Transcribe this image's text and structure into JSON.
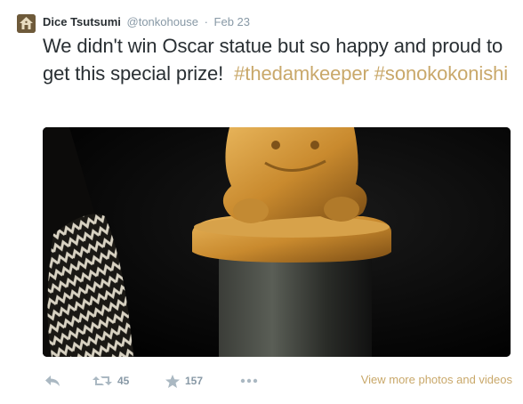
{
  "tweet": {
    "fullname": "Dice Tsutsumi",
    "username": "@tonkohouse",
    "separator": "·",
    "timestamp": "Feb 23",
    "text_plain": "We didn't win Oscar statue but so happy and proud to get this special prize!",
    "hashtags": [
      "#thedamkeeper",
      "#sonokokonishi"
    ],
    "accent_color": "#c9a86a"
  },
  "actions": {
    "reply_icon": "reply-icon",
    "retweet_icon": "retweet-icon",
    "retweet_count": "45",
    "favorite_icon": "star-icon",
    "favorite_count": "157",
    "more_icon": "ellipsis-icon",
    "view_more_label": "View more photos and videos"
  }
}
